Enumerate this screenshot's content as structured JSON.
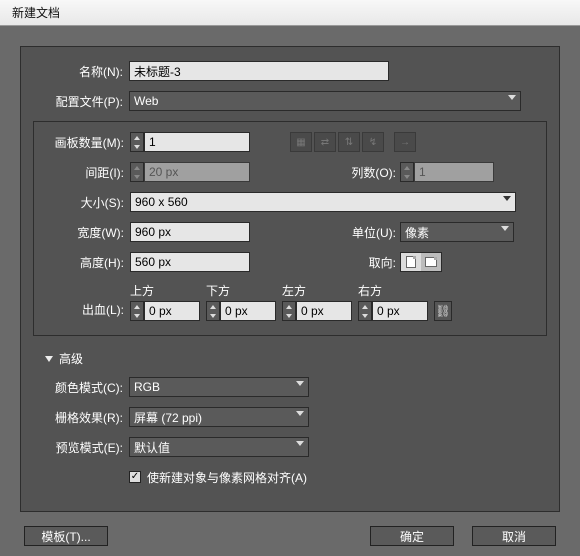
{
  "title": "新建文档",
  "labels": {
    "name": "名称(N):",
    "profile": "配置文件(P):",
    "artboards": "画板数量(M):",
    "spacing": "间距(I):",
    "columns": "列数(O):",
    "size": "大小(S):",
    "width": "宽度(W):",
    "height": "高度(H):",
    "units": "单位(U):",
    "orientation": "取向:",
    "bleed": "出血(L):",
    "top": "上方",
    "bottom": "下方",
    "left": "左方",
    "right": "右方",
    "advanced": "高级",
    "colormode": "颜色模式(C):",
    "raster": "栅格效果(R):",
    "preview": "预览模式(E):",
    "align_px": "使新建对象与像素网格对齐(A)"
  },
  "values": {
    "name": "未标题-3",
    "profile": "Web",
    "artboards": "1",
    "spacing": "20 px",
    "columns": "1",
    "size": "960 x 560",
    "width": "960 px",
    "height": "560 px",
    "units": "像素",
    "bleed_t": "0 px",
    "bleed_b": "0 px",
    "bleed_l": "0 px",
    "bleed_r": "0 px",
    "colormode": "RGB",
    "raster": "屏幕 (72 ppi)",
    "preview": "默认值",
    "align_checked": "✓"
  },
  "buttons": {
    "template": "模板(T)...",
    "ok": "确定",
    "cancel": "取消"
  }
}
